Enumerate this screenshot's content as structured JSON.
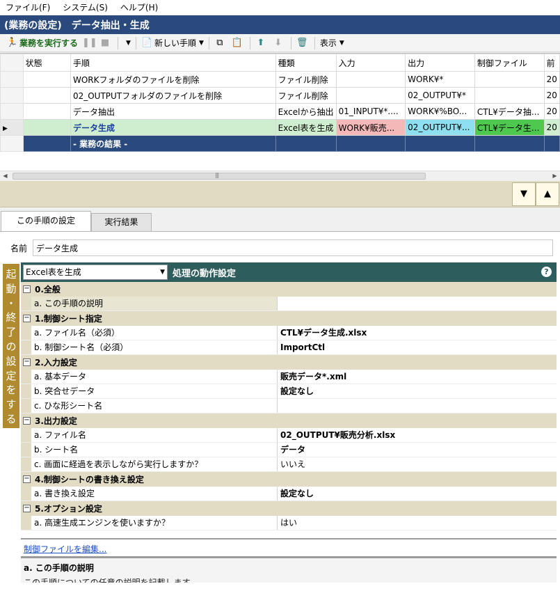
{
  "menu": [
    "ファイル(F)",
    "システム(S)",
    "ヘルプ(H)"
  ],
  "title": {
    "section": "(業務の設定)",
    "name": "データ抽出・生成"
  },
  "toolbar": {
    "run_label": "業務を実行する",
    "new_step_label": "新しい手順",
    "view_label": "表示"
  },
  "grid": {
    "columns": [
      "状態",
      "手順",
      "種類",
      "入力",
      "出力",
      "制御ファイル",
      "前"
    ],
    "rows": [
      {
        "status": "",
        "step": "WORKフォルダのファイルを削除",
        "type": "ファイル削除",
        "input": "",
        "output": "WORK¥*",
        "ctl": "",
        "prev": "20"
      },
      {
        "status": "",
        "step": "02_OUTPUTフォルダのファイルを削除",
        "type": "ファイル削除",
        "input": "",
        "output": "02_OUTPUT¥*",
        "ctl": "",
        "prev": "20"
      },
      {
        "status": "",
        "step": "データ抽出",
        "type": "Excelから抽出",
        "input": "01_INPUT¥*....",
        "output": "WORK¥%BO...",
        "ctl": "CTL¥データ抽...",
        "prev": "20"
      },
      {
        "status": "",
        "step": "データ生成",
        "type": "Excel表を生成",
        "input": "WORK¥販売...",
        "output": "02_OUTPUT¥...",
        "ctl": "CTL¥データ生...",
        "prev": "20"
      }
    ],
    "result_row": "- 業務の結果 -"
  },
  "tabs": {
    "active": "この手順の設定",
    "inactive": "実行結果"
  },
  "settings": {
    "name_label": "名前",
    "name_value": "データ生成",
    "side_tab": [
      "起",
      "動",
      "・",
      "終",
      "了",
      "の",
      "設",
      "定",
      "を",
      "す",
      "る"
    ],
    "action_type": "Excel表を生成",
    "header_title": "処理の動作設定",
    "help": "?",
    "categories": [
      {
        "title": "0.全般",
        "props": [
          {
            "name": "a. この手順の説明",
            "value": ""
          }
        ]
      },
      {
        "title": "1.制御シート指定",
        "props": [
          {
            "name": "a. ファイル名（必須）",
            "value": "CTL¥データ生成.xlsx"
          },
          {
            "name": "b. 制御シート名（必須）",
            "value": "ImportCtl"
          }
        ]
      },
      {
        "title": "2.入力設定",
        "props": [
          {
            "name": "a. 基本データ",
            "value": "販売データ*.xml"
          },
          {
            "name": "b. 突合せデータ",
            "value": "設定なし"
          },
          {
            "name": "c. ひな形シート名",
            "value": ""
          }
        ]
      },
      {
        "title": "3.出力設定",
        "props": [
          {
            "name": "a. ファイル名",
            "value": "02_OUTPUT¥販売分析.xlsx"
          },
          {
            "name": "b. シート名",
            "value": "データ"
          },
          {
            "name": "c. 画面に経過を表示しながら実行しますか？",
            "value": "いいえ"
          }
        ]
      },
      {
        "title": "4.制御シートの書き換え設定",
        "props": [
          {
            "name": "a. 書き換え設定",
            "value": "設定なし"
          }
        ]
      },
      {
        "title": "5.オプション設定",
        "props": [
          {
            "name": "a. 高速生成エンジンを使いますか？",
            "value": "はい"
          }
        ]
      }
    ],
    "edit_link": "制御ファイルを編集...",
    "description_title": "a. この手順の説明",
    "description_text": "この手順についての任意の説明を記載します。"
  }
}
